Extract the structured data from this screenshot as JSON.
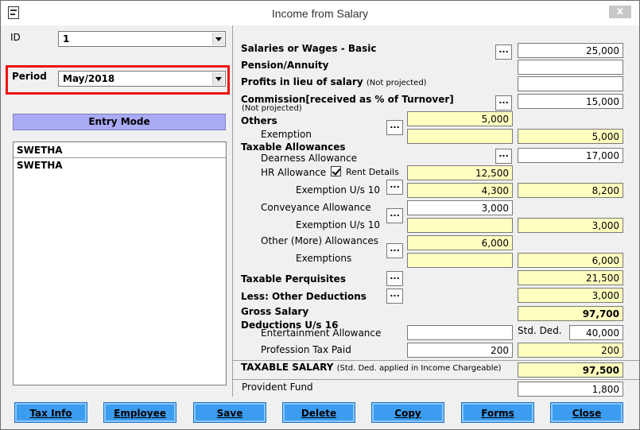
{
  "window": {
    "title": "Income from Salary",
    "close_label": "x"
  },
  "left": {
    "id_label": "ID",
    "id_value": "1",
    "period_label": "Period",
    "period_value": "May/2018",
    "entry_mode": "Entry Mode",
    "list_header": "SWETHA",
    "list_items": [
      "SWETHA"
    ]
  },
  "form": {
    "salaries_label": "Salaries or Wages - Basic",
    "salaries_value": "25,000",
    "pension_label": "Pension/Annuity",
    "pension_value": "",
    "profits_label": "Profits in lieu of salary",
    "profits_note": "(Not projected)",
    "profits_value": "",
    "commission_label": "Commission[received as % of Turnover]",
    "commission_note": "(Not projected)",
    "commission_value": "15,000",
    "others_label": "Others",
    "others_value": "5,000",
    "exemption_label": "Exemption",
    "exemption_left": "",
    "exemption_value": "5,000",
    "taxable_allow_label": "Taxable Allowances",
    "dearness_label": "Dearness Allowance",
    "dearness_value": "17,000",
    "hra_label": "HR Allowance",
    "rent_details_label": "Rent Details",
    "hra_value": "12,500",
    "hra_exemption_label": "Exemption U/s 10",
    "hra_exemption_left": "4,300",
    "hra_exemption_value": "8,200",
    "conveyance_label": "Conveyance Allowance",
    "conveyance_value": "3,000",
    "conv_exemption_label": "Exemption U/s 10",
    "conv_exemption_left": "",
    "conv_exemption_value": "3,000",
    "other_allow_label": "Other (More) Allowances",
    "other_allow_value": "6,000",
    "exemptions_label": "Exemptions",
    "exemptions_left": "",
    "exemptions_value": "6,000",
    "perquisites_label": "Taxable Perquisites",
    "perquisites_value": "21,500",
    "other_deductions_label": "Less: Other Deductions",
    "other_deductions_value": "3,000",
    "gross_label": "Gross Salary",
    "gross_value": "97,700",
    "deductions_label": "Deductions U/s 16",
    "entertainment_label": "Entertainment Allowance",
    "entertainment_value": "",
    "std_ded_label": "Std. Ded.",
    "std_ded_value": "40,000",
    "prof_tax_label": "Profession Tax Paid",
    "prof_tax_left": "200",
    "prof_tax_value": "200",
    "taxable_salary_label": "TAXABLE SALARY",
    "taxable_salary_note": "(Std. Ded. applied in Income Chargeable)",
    "taxable_salary_value": "97,500",
    "pf_label": "Provident Fund",
    "pf_value": "1,800",
    "dots_label": "..."
  },
  "buttons": {
    "tax_info": "Tax Info",
    "employee": "Employee",
    "save": "Save",
    "delete": "Delete",
    "copy": "Copy",
    "forms": "Forms",
    "close": "Close"
  },
  "colors": {
    "accent_button": "#3c9cf0",
    "highlight_field": "#ffffc0",
    "entry_mode": "#aaaaf5",
    "annotation_box": "#ee1111"
  }
}
